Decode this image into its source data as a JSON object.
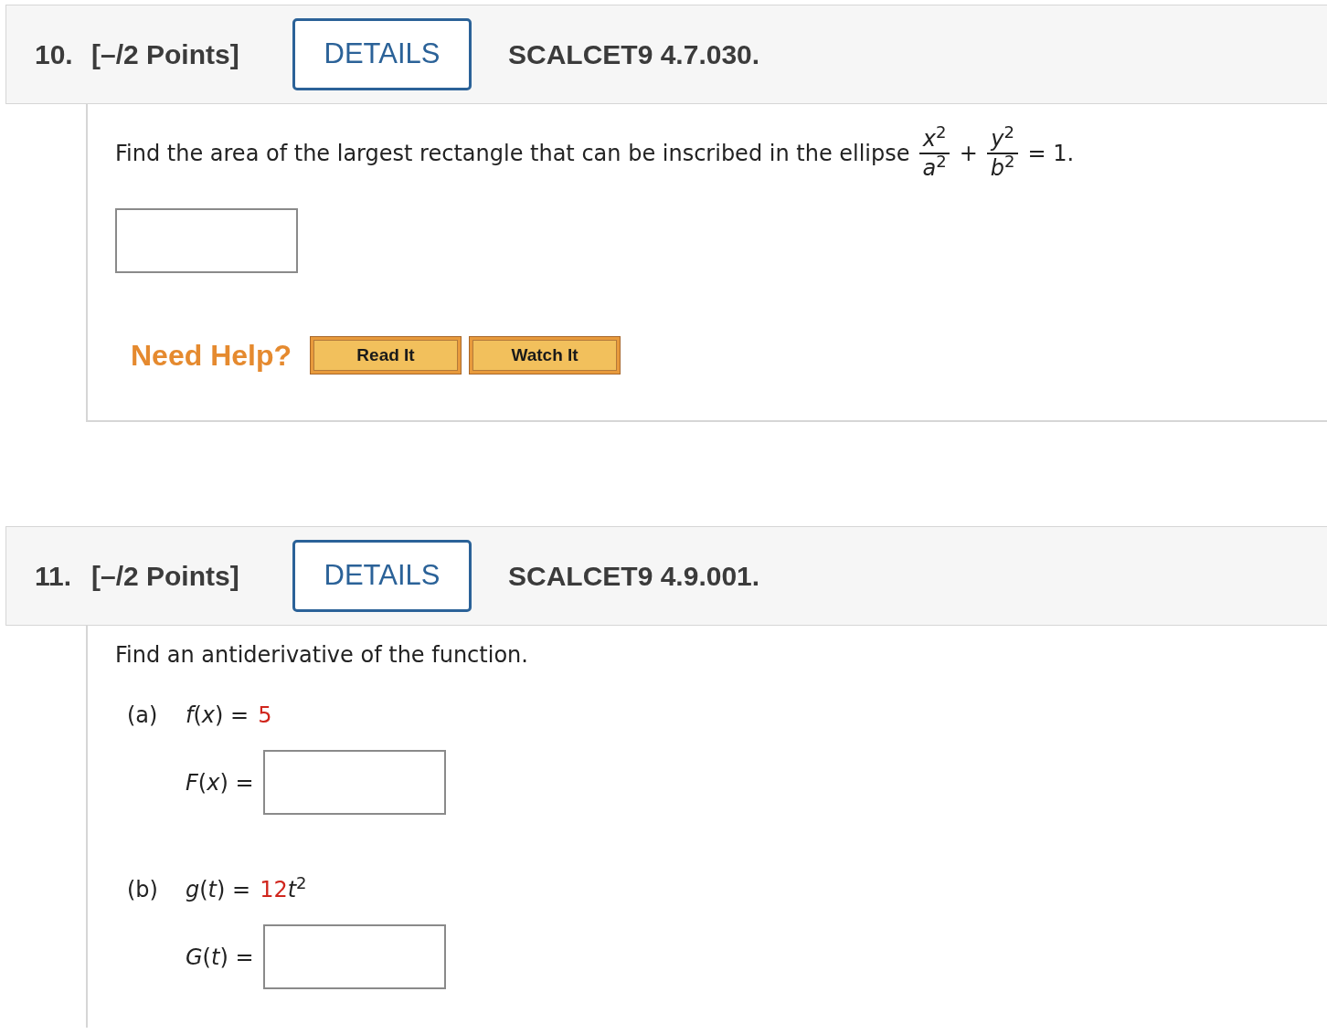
{
  "questions": [
    {
      "kind": "single_answer",
      "number": "10.",
      "points": "[–/2 Points]",
      "details_button": "DETAILS",
      "code": "SCALCET9 4.7.030.",
      "prompt": "Find the area of the largest rectangle that can be inscribed in the ellipse",
      "equation": {
        "fractions": [
          {
            "numerator": "*x*$^{2}$",
            "denominator": "*a*$^{2}$"
          },
          {
            "numerator": "*y*$^{2}$",
            "denominator": "*b*$^{2}$"
          }
        ],
        "operator": "+",
        "rhs": "= 1."
      },
      "help": {
        "label": "Need Help?",
        "buttons": [
          "Read It",
          "Watch It"
        ]
      }
    },
    {
      "kind": "parts",
      "number": "11.",
      "points": "[–/2 Points]",
      "details_button": "DETAILS",
      "code": "SCALCET9 4.9.001.",
      "prompt": "Find an antiderivative of the function.",
      "parts": [
        {
          "label": "(a)",
          "given_lhs": "*f*(*x*) =",
          "given_value": "5",
          "answer_lhs": "*F*(*x*) ="
        },
        {
          "label": "(b)",
          "given_lhs": "*g*(*t*) =",
          "given_value": "12",
          "given_tail": "*t*$^{2}$",
          "answer_lhs": "*G*(*t*) ="
        }
      ]
    }
  ]
}
